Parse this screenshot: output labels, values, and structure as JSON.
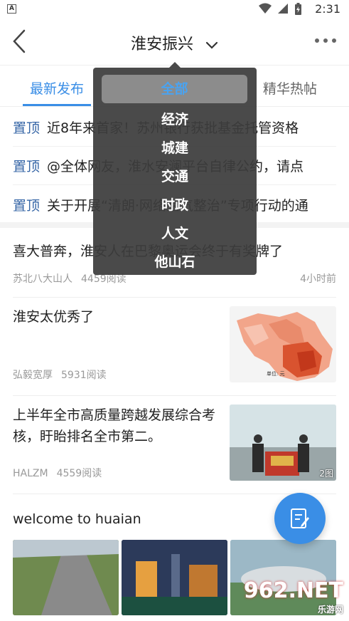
{
  "status": {
    "time": "2:31",
    "app_badge": "A"
  },
  "header": {
    "title": "淮安振兴"
  },
  "tabs": [
    {
      "label": "最新发布"
    },
    {
      "label": "精华热帖"
    }
  ],
  "pinned": [
    {
      "tag": "置顶",
      "title": "近8年来首家！苏州银行获批基金托管资格"
    },
    {
      "tag": "置顶",
      "title": "@全体网友，淮水安澜平台自律公约，请点"
    },
    {
      "tag": "置顶",
      "title": "关于开展“清朗·网络空气整治”专项行动的通"
    }
  ],
  "posts": [
    {
      "title": "喜大普奔，淮安人在巴黎奥运会终于有奖牌了",
      "author": "苏北八大山人",
      "views": "4459阅读",
      "time": "4小时前"
    },
    {
      "title": "淮安太优秀了",
      "author": "弘毅宽厚",
      "views": "5931阅读"
    },
    {
      "title": "上半年全市高质量跨越发展综合考核，盱眙排名全市第二。",
      "author": "HALZM",
      "views": "4559阅读",
      "badge": "2图"
    },
    {
      "title": "welcome to huaian"
    }
  ],
  "dropdown": {
    "items": [
      "全部",
      "经济",
      "城建",
      "交通",
      "时政",
      "人文",
      "他山石"
    ],
    "selected": "全部"
  },
  "map_labels": [
    "单位: 元"
  ],
  "watermark": {
    "brand": "962.NET",
    "sub": "乐游网"
  },
  "colors": {
    "accent": "#3a8ee6",
    "pinned_tag": "#3565a6"
  }
}
